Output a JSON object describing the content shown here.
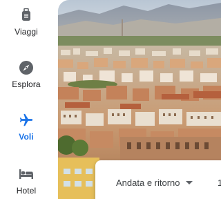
{
  "nav": {
    "items": [
      {
        "label": "Viaggi",
        "icon": "suitcase-icon"
      },
      {
        "label": "Esplora",
        "icon": "compass-icon"
      },
      {
        "label": "Voli",
        "icon": "airplane-icon",
        "active": true
      },
      {
        "label": "Hotel",
        "icon": "bed-icon"
      }
    ]
  },
  "search": {
    "trip_type": "Andata e ritorno",
    "passengers": "1"
  },
  "colors": {
    "accent": "#1a73e8",
    "icon": "#5f6368",
    "text": "#202124"
  }
}
